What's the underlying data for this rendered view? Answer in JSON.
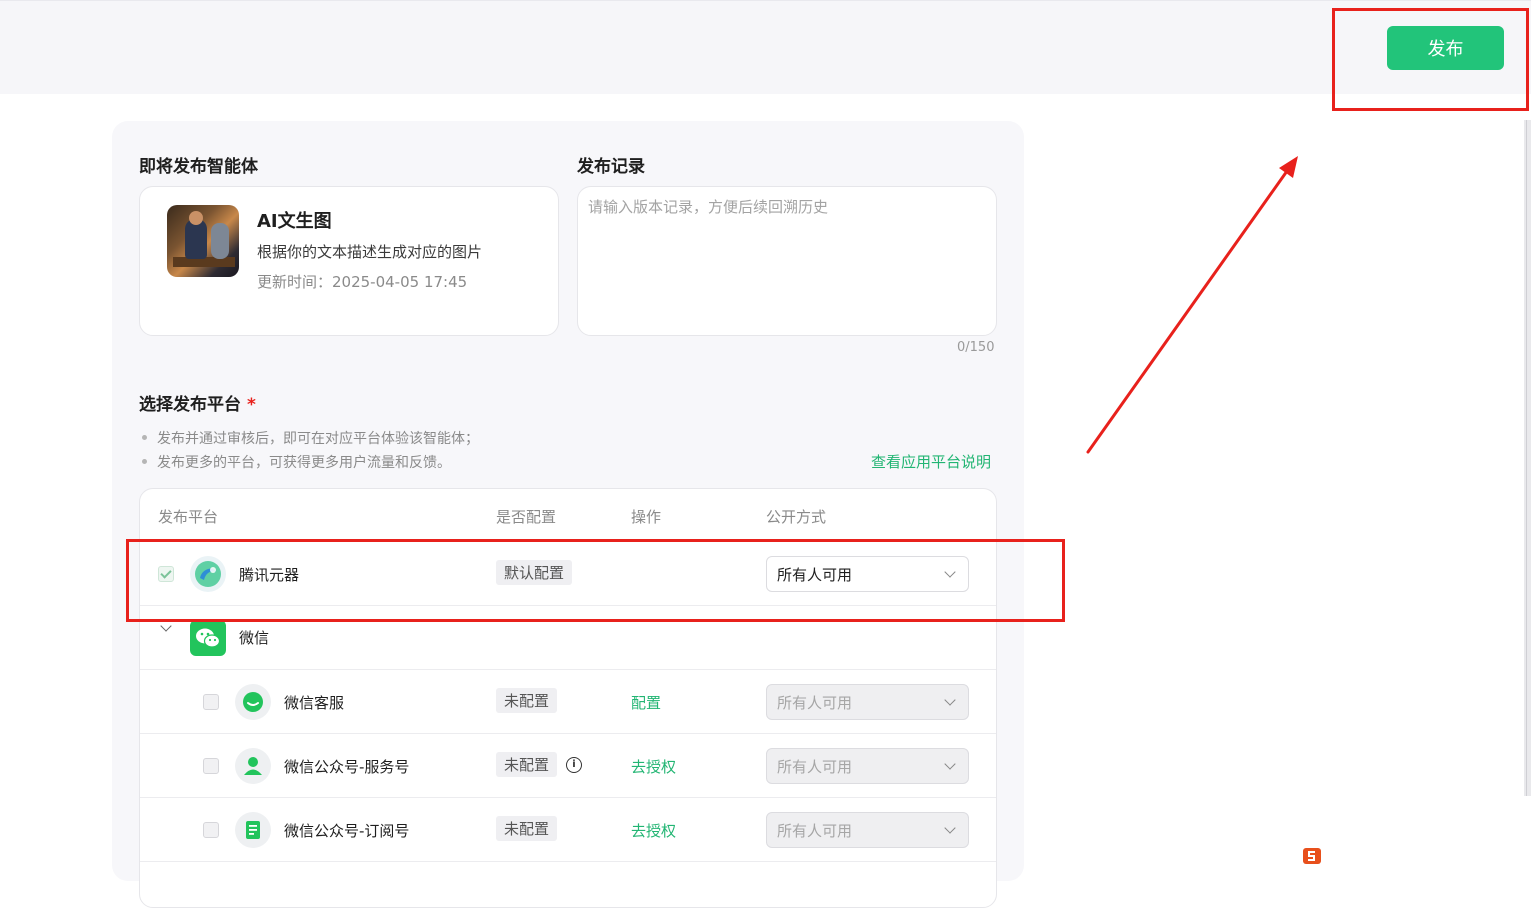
{
  "header": {
    "publish_label": "发布"
  },
  "agent_section": {
    "title": "即将发布智能体",
    "agent": {
      "name": "AI文生图",
      "description": "根据你的文本描述生成对应的图片",
      "updated": "更新时间：2025-04-05 17:45"
    }
  },
  "record_section": {
    "title": "发布记录",
    "placeholder": "请输入版本记录，方便后续回溯历史",
    "counter": "0/150"
  },
  "platform_section": {
    "title": "选择发布平台",
    "required_mark": "*",
    "notes": [
      "发布并通过审核后，即可在对应平台体验该智能体；",
      "发布更多的平台，可获得更多用户流量和反馈。"
    ],
    "help_link": "查看应用平台说明",
    "columns": [
      "发布平台",
      "是否配置",
      "操作",
      "公开方式"
    ],
    "rows": [
      {
        "name": "腾讯元器",
        "status": "默认配置",
        "action": "",
        "visibility": "所有人可用",
        "checked": true,
        "disabled": false,
        "icon": "yuanqi-icon"
      },
      {
        "name": "微信",
        "group": true,
        "icon": "wechat-icon"
      },
      {
        "name": "微信客服",
        "status": "未配置",
        "action": "配置",
        "visibility": "所有人可用",
        "checked": false,
        "disabled": true,
        "icon": "wechat-service-icon"
      },
      {
        "name": "微信公众号-服务号",
        "status": "未配置",
        "action": "去授权",
        "visibility": "所有人可用",
        "checked": false,
        "disabled": true,
        "icon": "official-account-service-icon",
        "info": "i"
      },
      {
        "name": "微信公众号-订阅号",
        "status": "未配置",
        "action": "去授权",
        "visibility": "所有人可用",
        "checked": false,
        "disabled": true,
        "icon": "official-account-subscription-icon"
      }
    ]
  },
  "colors": {
    "accent": "#22c47a",
    "link": "#22b573",
    "annotation": "#e8211c"
  }
}
